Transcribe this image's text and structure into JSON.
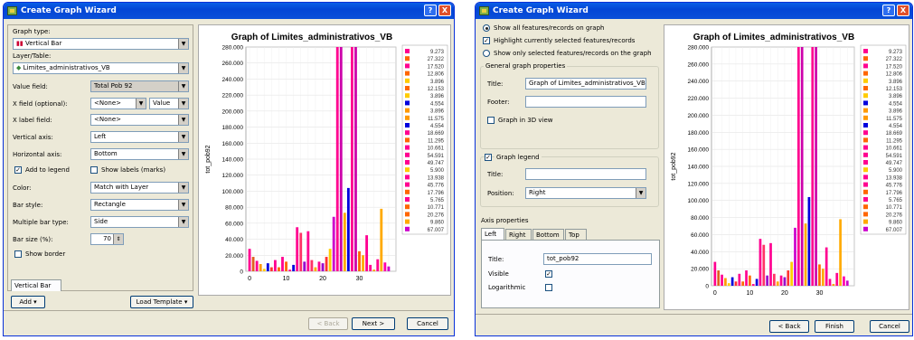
{
  "window_title": "Create Graph Wizard",
  "title_buttons": {
    "help": "?",
    "close": "X"
  },
  "left": {
    "graph_type_label": "Graph type:",
    "graph_type_value": "Vertical Bar",
    "layer_label": "Layer/Table:",
    "layer_value": "Limites_administrativos_VB",
    "value_field_label": "Value field:",
    "value_field_value": "Total Pob 92",
    "x_field_label": "X field (optional):",
    "x_field_value": "<None>",
    "x_field_sort": "Value",
    "x_label_field_label": "X label field:",
    "x_label_field_value": "<None>",
    "vertical_axis_label": "Vertical axis:",
    "vertical_axis_value": "Left",
    "horizontal_axis_label": "Horizontal axis:",
    "horizontal_axis_value": "Bottom",
    "add_to_legend_label": "Add to legend",
    "show_labels_label": "Show labels (marks)",
    "color_label": "Color:",
    "color_value": "Match with Layer",
    "bar_style_label": "Bar style:",
    "bar_style_value": "Rectangle",
    "multiple_bar_label": "Multiple bar type:",
    "multiple_bar_value": "Side",
    "bar_size_label": "Bar size (%):",
    "bar_size_value": "70",
    "show_border_label": "Show border",
    "series_tab": "Vertical Bar",
    "add_button": "Add",
    "load_template_button": "Load Template",
    "back_button": "< Back",
    "next_button": "Next >",
    "cancel_button": "Cancel"
  },
  "right": {
    "radio_show_all": "Show all features/records on graph",
    "chk_highlight": "Highlight currently selected features/records",
    "radio_show_selected": "Show only selected features/records on the graph",
    "general_props": "General graph properties",
    "title_label": "Title:",
    "title_value": "Graph of Limites_administrativos_VB",
    "footer_label": "Footer:",
    "graph3d_label": "Graph in 3D view",
    "graph_legend_label": "Graph legend",
    "legend_title_label": "Title:",
    "position_label": "Position:",
    "position_value": "Right",
    "axis_props": "Axis properties",
    "axis_tabs": [
      "Left",
      "Right",
      "Bottom",
      "Top"
    ],
    "axis_title_label": "Title:",
    "axis_title_value": "tot_pob92",
    "visible_label": "Visible",
    "logarithmic_label": "Logarithmic",
    "back_button": "< Back",
    "finish_button": "Finish",
    "cancel_button": "Cancel"
  },
  "chart_data": {
    "type": "bar",
    "title": "Graph of Limites_administrativos_VB",
    "ylabel": "tot_pob92",
    "ylim": [
      0,
      280000
    ],
    "yticks": [
      "0",
      "20.000",
      "40.000",
      "60.000",
      "80.000",
      "100.000",
      "120.000",
      "140.000",
      "160.000",
      "180.000",
      "200.000",
      "220.000",
      "240.000",
      "260.000",
      "280.000"
    ],
    "xticks": [
      "0",
      "10",
      "20",
      "30"
    ],
    "xlim": [
      -1,
      40
    ],
    "values": [
      28000,
      18000,
      13000,
      9000,
      3000,
      10000,
      5000,
      14000,
      5000,
      18000,
      12000,
      2000,
      8000,
      55000,
      48000,
      12000,
      50000,
      14000,
      5000,
      12000,
      10000,
      18000,
      28000,
      68000,
      300000,
      300000,
      73000,
      104000,
      300000,
      300000,
      25000,
      20000,
      45000,
      8000,
      2000,
      15000,
      78000,
      11000,
      6000
    ],
    "colors": [
      "#ff0090",
      "#e06020",
      "#ff0090",
      "#ff9900",
      "#ffcc00",
      "#0000dd",
      "#ff3333",
      "#ff0090",
      "#ff6600",
      "#ff0090",
      "#ff6600",
      "#ff0090",
      "#0000dd",
      "#ff0090",
      "#ff3366",
      "#9900cc",
      "#ff0090",
      "#ff3366",
      "#ffaa00",
      "#ff0090",
      "#9900cc",
      "#ff3333",
      "#ffcc00",
      "#cc00cc",
      "#ff0090",
      "#cc00aa",
      "#ffaa00",
      "#0000dd",
      "#ff0090",
      "#cc00aa",
      "#ff6600",
      "#ffaa00",
      "#ff0090",
      "#ff0090",
      "#ff9900",
      "#ff0090",
      "#ffaa00",
      "#ff00aa",
      "#cc00cc"
    ],
    "legend": [
      "9.273",
      "27.322",
      "17.520",
      "12.806",
      "3.896",
      "12.153",
      "3.896",
      "4.554",
      "3.896",
      "11.575",
      "4.554",
      "18.669",
      "11.295",
      "10.661",
      "54.591",
      "49.747",
      "5.900",
      "13.938",
      "45.776",
      "17.796",
      "5.765",
      "10.771",
      "20.276",
      "9.860",
      "67.007"
    ],
    "legend_colors": [
      "#ff0090",
      "#ff6600",
      "#ff0090",
      "#ff6600",
      "#ffcc00",
      "#ff6600",
      "#ffcc00",
      "#0000dd",
      "#ff9900",
      "#ff9900",
      "#0000dd",
      "#ff0090",
      "#ff6600",
      "#ff0090",
      "#ff0090",
      "#ff0090",
      "#ffcc00",
      "#ff0090",
      "#ff0090",
      "#ff6600",
      "#ff0090",
      "#ff6600",
      "#ff6600",
      "#ffaa00",
      "#cc00cc"
    ]
  }
}
